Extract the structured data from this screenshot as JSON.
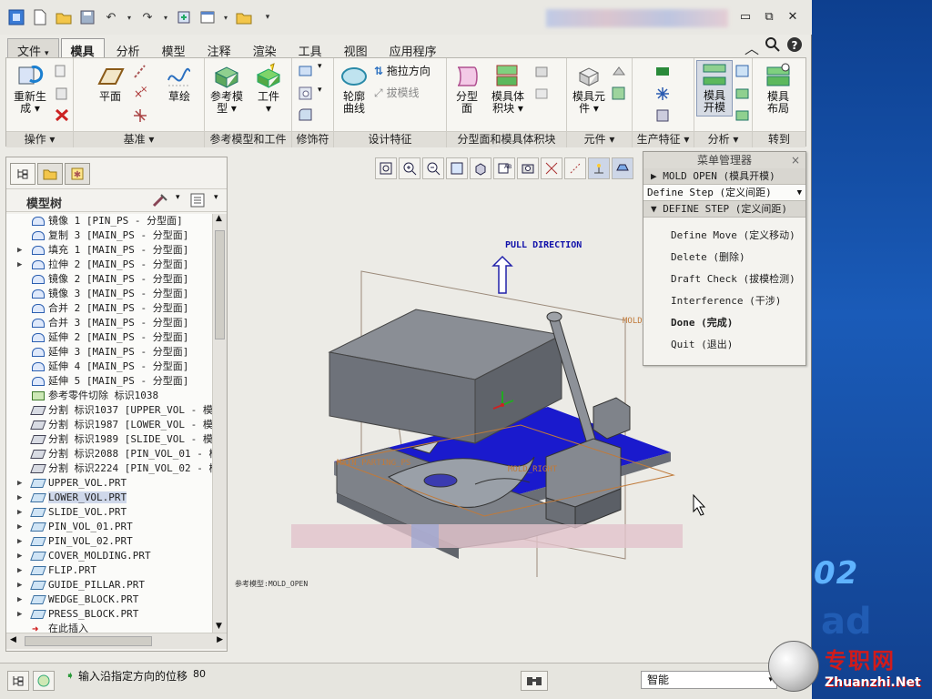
{
  "ribbon": {
    "tabs": [
      {
        "label": "文件",
        "kind": "file"
      },
      {
        "label": "模具",
        "kind": "active"
      },
      {
        "label": "分析"
      },
      {
        "label": "模型"
      },
      {
        "label": "注释"
      },
      {
        "label": "渲染"
      },
      {
        "label": "工具"
      },
      {
        "label": "视图"
      },
      {
        "label": "应用程序"
      }
    ],
    "file_dropdown": "▾",
    "groups": {
      "operations": {
        "title": "操作",
        "regenerate": "重新生",
        "regenerate2": "成"
      },
      "datum": {
        "title": "基准",
        "plane": "平面",
        "sketch": "草绘"
      },
      "refmodel": {
        "title": "参考模型和工件",
        "ref_model": "参考模",
        "ref_model2": "型",
        "workpiece": "工件"
      },
      "modifiers": {
        "title": "修饰符"
      },
      "design": {
        "title": "设计特征",
        "profile_curve": "轮廓",
        "profile_curve2": "曲线",
        "drag_dir": "拖拉方向",
        "draft_line": "拔模线"
      },
      "parting": {
        "title": "分型面和模具体积块",
        "parting_surface": "分型",
        "parting_surface2": "面",
        "mold_volume": "模具体",
        "mold_volume2": "积块"
      },
      "component": {
        "title": "元件",
        "mold_component": "模具元",
        "mold_component2": "件"
      },
      "production": {
        "title": "生产特征"
      },
      "analysis": {
        "title": "分析",
        "mold_open": "模具",
        "mold_open2": "开模"
      },
      "goto": {
        "title": "转到",
        "mold_layout": "模具",
        "mold_layout2": "布局"
      }
    }
  },
  "left_panel": {
    "title": "模型树",
    "tree": [
      {
        "type": "srf",
        "text": "镜像 1 [PIN_PS - 分型面]",
        "expand": false
      },
      {
        "type": "srf",
        "text": "复制 3 [MAIN_PS - 分型面]",
        "expand": false
      },
      {
        "type": "srf",
        "text": "填充 1 [MAIN_PS - 分型面]",
        "expand": true
      },
      {
        "type": "srf",
        "text": "拉伸 2 [MAIN_PS - 分型面]",
        "expand": true
      },
      {
        "type": "srf",
        "text": "镜像 2 [MAIN_PS - 分型面]",
        "expand": false
      },
      {
        "type": "srf",
        "text": "镜像 3 [MAIN_PS - 分型面]",
        "expand": false
      },
      {
        "type": "srf",
        "text": "合并 2 [MAIN_PS - 分型面]",
        "expand": false
      },
      {
        "type": "srf",
        "text": "合并 3 [MAIN_PS - 分型面]",
        "expand": false
      },
      {
        "type": "srf",
        "text": "延伸 2 [MAIN_PS - 分型面]",
        "expand": false
      },
      {
        "type": "srf",
        "text": "延伸 3 [MAIN_PS - 分型面]",
        "expand": false
      },
      {
        "type": "srf",
        "text": "延伸 4 [MAIN_PS - 分型面]",
        "expand": false
      },
      {
        "type": "srf",
        "text": "延伸 5 [MAIN_PS - 分型面]",
        "expand": false
      },
      {
        "type": "cut",
        "text": "参考零件切除 标识1038",
        "expand": false
      },
      {
        "type": "vol",
        "text": "分割 标识1037 [UPPER_VOL - 模…",
        "expand": false
      },
      {
        "type": "vol",
        "text": "分割 标识1987 [LOWER_VOL - 模…",
        "expand": false
      },
      {
        "type": "vol",
        "text": "分割 标识1989 [SLIDE_VOL - 模…",
        "expand": false
      },
      {
        "type": "vol",
        "text": "分割 标识2088 [PIN_VOL_01 - 模",
        "expand": false
      },
      {
        "type": "vol",
        "text": "分割 标识2224 [PIN_VOL_02 - 模",
        "expand": false
      },
      {
        "type": "prt",
        "text": "UPPER_VOL.PRT",
        "expand": true
      },
      {
        "type": "prt",
        "text": "LOWER_VOL.PRT",
        "expand": true,
        "selected": true
      },
      {
        "type": "prt",
        "text": "SLIDE_VOL.PRT",
        "expand": true
      },
      {
        "type": "prt",
        "text": "PIN_VOL_01.PRT",
        "expand": true
      },
      {
        "type": "prt",
        "text": "PIN_VOL_02.PRT",
        "expand": true
      },
      {
        "type": "prt",
        "text": "COVER_MOLDING.PRT",
        "expand": true
      },
      {
        "type": "prt",
        "text": "FLIP.PRT",
        "expand": true
      },
      {
        "type": "prt",
        "text": "GUIDE_PILLAR.PRT",
        "expand": true
      },
      {
        "type": "prt",
        "text": "WEDGE_BLOCK.PRT",
        "expand": true
      },
      {
        "type": "prt",
        "text": "PRESS_BLOCK.PRT",
        "expand": true
      },
      {
        "type": "ins",
        "text": "在此插入",
        "expand": false
      }
    ]
  },
  "graphics": {
    "pull_direction": "PULL DIRECTION",
    "main_parting": "MAIN_PARTING_PS",
    "mold_right": "MOLD_RIGHT",
    "mold_top": "MOLD_",
    "view_name": "参考模型:MOLD_OPEN"
  },
  "menu_manager": {
    "title": "菜单管理器",
    "close": "×",
    "header1": "MOLD OPEN (模具开模)",
    "dropdown": "Define Step (定义间距)",
    "header2": "DEFINE STEP (定义间距)",
    "items": [
      {
        "label": "Define Move (定义移动)"
      },
      {
        "label": "Delete (删除)"
      },
      {
        "label": "Draft Check (拔模检测)"
      },
      {
        "label": "Interference (干涉)"
      },
      {
        "label": "Done (完成)",
        "bold": true
      },
      {
        "label": "Quit (退出)"
      }
    ]
  },
  "status": {
    "message": "输入沿指定方向的位移",
    "value": "80",
    "filter": "智能"
  },
  "desktop": {
    "brand_text": "02",
    "brand_shadow": "ad"
  },
  "watermark": {
    "cn": "专职网",
    "url": "Zhuanzhi.Net"
  }
}
